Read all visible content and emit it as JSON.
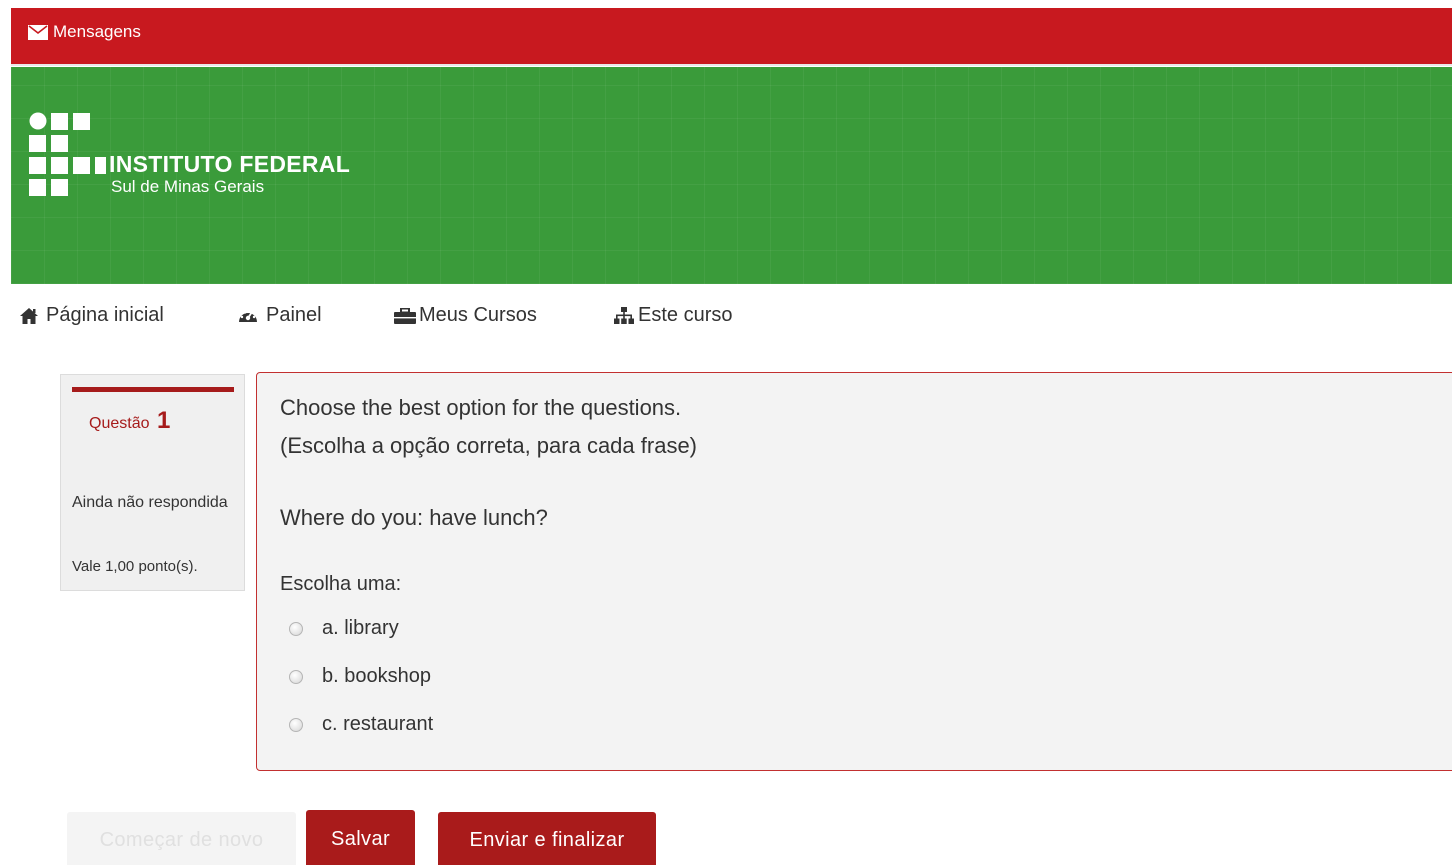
{
  "topbar": {
    "messages_label": "Mensagens",
    "color": "#c8191f"
  },
  "header": {
    "logo_title": "INSTITUTO FEDERAL",
    "logo_subtitle": "Sul de Minas Gerais",
    "color": "#3a9b3a"
  },
  "nav": {
    "items": [
      {
        "label": "Página inicial",
        "icon": "home-icon"
      },
      {
        "label": "Painel",
        "icon": "dashboard-icon"
      },
      {
        "label": "Meus Cursos",
        "icon": "briefcase-icon"
      },
      {
        "label": "Este curso",
        "icon": "sitemap-icon"
      }
    ]
  },
  "question": {
    "label": "Questão",
    "number": "1",
    "state": "Ainda não respondida",
    "grade": "Vale 1,00 ponto(s).",
    "text_line1": "Choose the best option for the questions.",
    "text_line2": "(Escolha a opção correta, para cada frase)",
    "text_line3": "Where do you: have lunch?",
    "prompt": "Escolha uma:",
    "options": [
      {
        "label": "a. library"
      },
      {
        "label": "b. bookshop"
      },
      {
        "label": "c. restaurant"
      }
    ],
    "accent_color": "#a61b1b"
  },
  "buttons": {
    "restart_label": "Começar de novo",
    "save_label": "Salvar",
    "submit_label": "Enviar e finalizar"
  }
}
